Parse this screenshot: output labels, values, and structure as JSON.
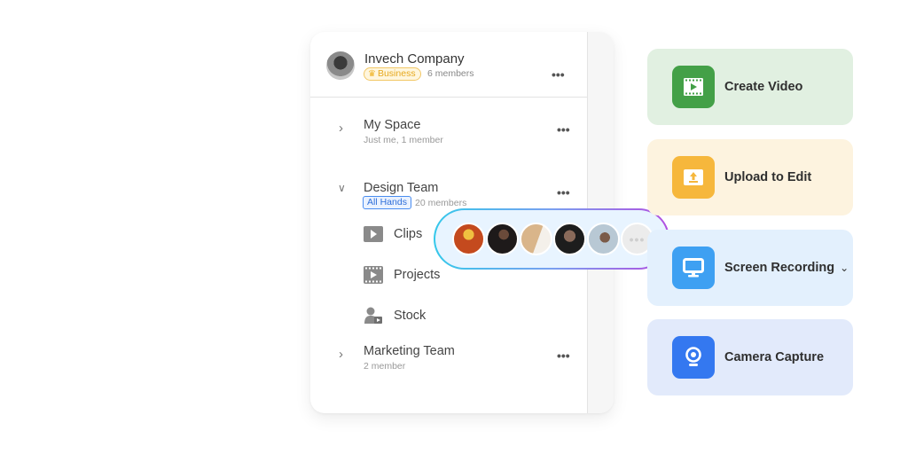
{
  "workspace": {
    "company": {
      "name": "Invech Company",
      "plan": "Business",
      "members": "6 members"
    },
    "groups": [
      {
        "title": "My Space",
        "subtitle": "Just me, 1 member",
        "expanded": false
      },
      {
        "title": "Design Team",
        "badge": "All Hands",
        "subtitle": "20 members",
        "expanded": true,
        "items": [
          {
            "label": "Clips",
            "icon": "play-icon"
          },
          {
            "label": "Projects",
            "icon": "film-icon"
          },
          {
            "label": "Stock",
            "icon": "stock-user-icon"
          }
        ]
      },
      {
        "title": "Marketing Team",
        "subtitle": "2 member",
        "expanded": false
      }
    ],
    "more_label": "•••"
  },
  "members_popover": {
    "avatars": [
      {
        "name": "member-1",
        "color": "#c44a1e"
      },
      {
        "name": "member-2",
        "color": "#1e1a1a"
      },
      {
        "name": "member-3",
        "color": "#d9b58a"
      },
      {
        "name": "member-4",
        "color": "#1d1d1d"
      },
      {
        "name": "member-5",
        "color": "#b8c8d4"
      }
    ],
    "more_label": "•••"
  },
  "actions": [
    {
      "label": "Create Video",
      "icon": "film-play-icon",
      "bg": "#e1f0e1",
      "icon_bg": "#43a047"
    },
    {
      "label": "Upload to Edit",
      "icon": "upload-icon",
      "bg": "#fdf3df",
      "icon_bg": "#f6b73c"
    },
    {
      "label": "Screen Recording",
      "icon": "monitor-icon",
      "bg": "#e3f0fd",
      "icon_bg": "#3ea0f2",
      "has_dropdown": true,
      "dropdown_glyph": "⌄"
    },
    {
      "label": "Camera Capture",
      "icon": "webcam-icon",
      "bg": "#e2eafb",
      "icon_bg": "#3478f0"
    }
  ]
}
